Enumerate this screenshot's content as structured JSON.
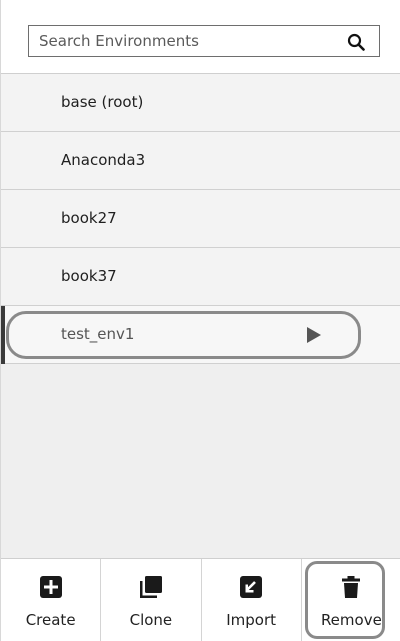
{
  "search": {
    "placeholder": "Search Environments",
    "icon": "search-icon"
  },
  "environments": [
    {
      "name": "base (root)",
      "selected": false
    },
    {
      "name": "Anaconda3",
      "selected": false
    },
    {
      "name": "book27",
      "selected": false
    },
    {
      "name": "book37",
      "selected": false
    },
    {
      "name": "test_env1",
      "selected": true
    }
  ],
  "actions": [
    {
      "label": "Create",
      "icon": "plus-square-icon"
    },
    {
      "label": "Clone",
      "icon": "clone-icon"
    },
    {
      "label": "Import",
      "icon": "import-icon"
    },
    {
      "label": "Remove",
      "icon": "trash-icon"
    }
  ],
  "colors": {
    "icon_dark": "#1a1a1a",
    "highlight": "#8a8a8a"
  }
}
